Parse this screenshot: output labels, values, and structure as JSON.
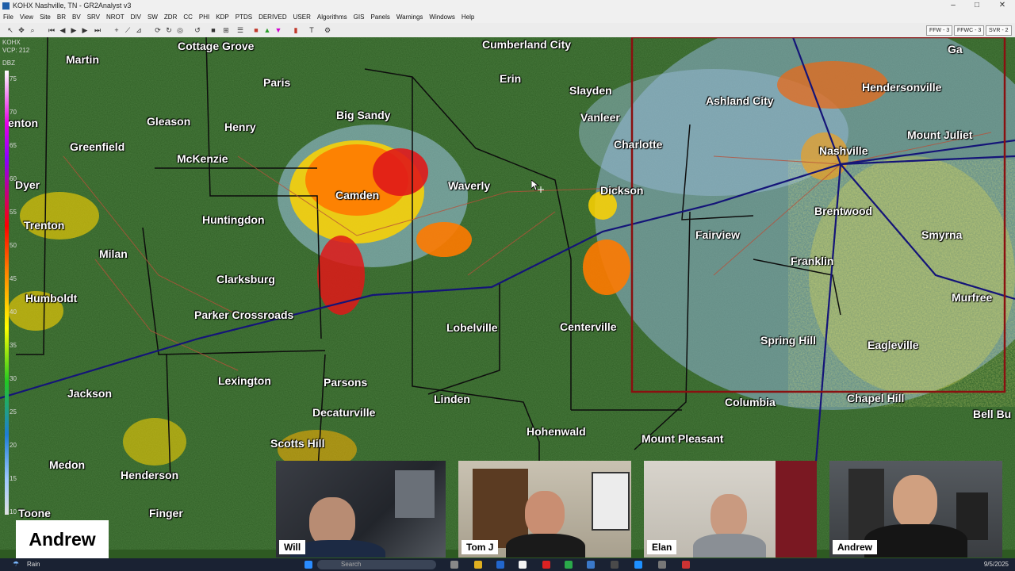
{
  "titlebar": {
    "title": "KOHX Nashville, TN - GR2Analyst v3"
  },
  "menu": [
    "File",
    "View",
    "Site",
    "BR",
    "BV",
    "SRV",
    "NROT",
    "DIV",
    "SW",
    "ZDR",
    "CC",
    "PHI",
    "KDP",
    "PTDS",
    "DERIVED",
    "USER",
    "Algorithms",
    "GIS",
    "Panels",
    "Warnings",
    "Windows",
    "Help"
  ],
  "toolbar": {
    "badges": [
      "FFW - 3",
      "FFWC - 3",
      "SVR - 2"
    ]
  },
  "radar": {
    "site": "KOHX",
    "vcp": "VCP: 212"
  },
  "scale": {
    "unit": "DBZ",
    "labels": [
      "75",
      "70",
      "65",
      "60",
      "55",
      "50",
      "45",
      "40",
      "35",
      "30",
      "25",
      "20",
      "15",
      "10"
    ]
  },
  "cities": [
    {
      "name": "Martin"
    },
    {
      "name": "Cottage Grove"
    },
    {
      "name": "Cumberland City"
    },
    {
      "name": "Paris"
    },
    {
      "name": "Erin"
    },
    {
      "name": "Slayden"
    },
    {
      "name": "Ashland City"
    },
    {
      "name": "Hendersonville"
    },
    {
      "name": "Gleason"
    },
    {
      "name": "Henry"
    },
    {
      "name": "Big Sandy"
    },
    {
      "name": "Vanleer"
    },
    {
      "name": "enton"
    },
    {
      "name": "Charlotte"
    },
    {
      "name": "Nashville"
    },
    {
      "name": "Mount Juliet"
    },
    {
      "name": "Greenfield"
    },
    {
      "name": "McKenzie"
    },
    {
      "name": "Dyer"
    },
    {
      "name": "Camden"
    },
    {
      "name": "Waverly"
    },
    {
      "name": "Dickson"
    },
    {
      "name": "Brentwood"
    },
    {
      "name": "Trenton"
    },
    {
      "name": "Huntingdon"
    },
    {
      "name": "Fairview"
    },
    {
      "name": "Smyrna"
    },
    {
      "name": "Milan"
    },
    {
      "name": "Franklin"
    },
    {
      "name": "Clarksburg"
    },
    {
      "name": "Humboldt"
    },
    {
      "name": "Murfree"
    },
    {
      "name": "Parker Crossroads"
    },
    {
      "name": "Lobelville"
    },
    {
      "name": "Centerville"
    },
    {
      "name": "Spring Hill"
    },
    {
      "name": "Eagleville"
    },
    {
      "name": "Lexington"
    },
    {
      "name": "Parsons"
    },
    {
      "name": "Jackson"
    },
    {
      "name": "Decaturville"
    },
    {
      "name": "Linden"
    },
    {
      "name": "Columbia"
    },
    {
      "name": "Chapel Hill"
    },
    {
      "name": "Bell Bu"
    },
    {
      "name": "Hohenwald"
    },
    {
      "name": "Mount Pleasant"
    },
    {
      "name": "Scotts Hill"
    },
    {
      "name": "Medon"
    },
    {
      "name": "Henderson"
    },
    {
      "name": "Toone"
    },
    {
      "name": "Finger"
    },
    {
      "name": "Ga"
    }
  ],
  "participants": [
    "Will",
    "Tom J",
    "Elan",
    "Andrew"
  ],
  "speaker": "Andrew",
  "taskbar": {
    "weather": "Rain",
    "search": "Search",
    "date": "9/5/2025"
  }
}
